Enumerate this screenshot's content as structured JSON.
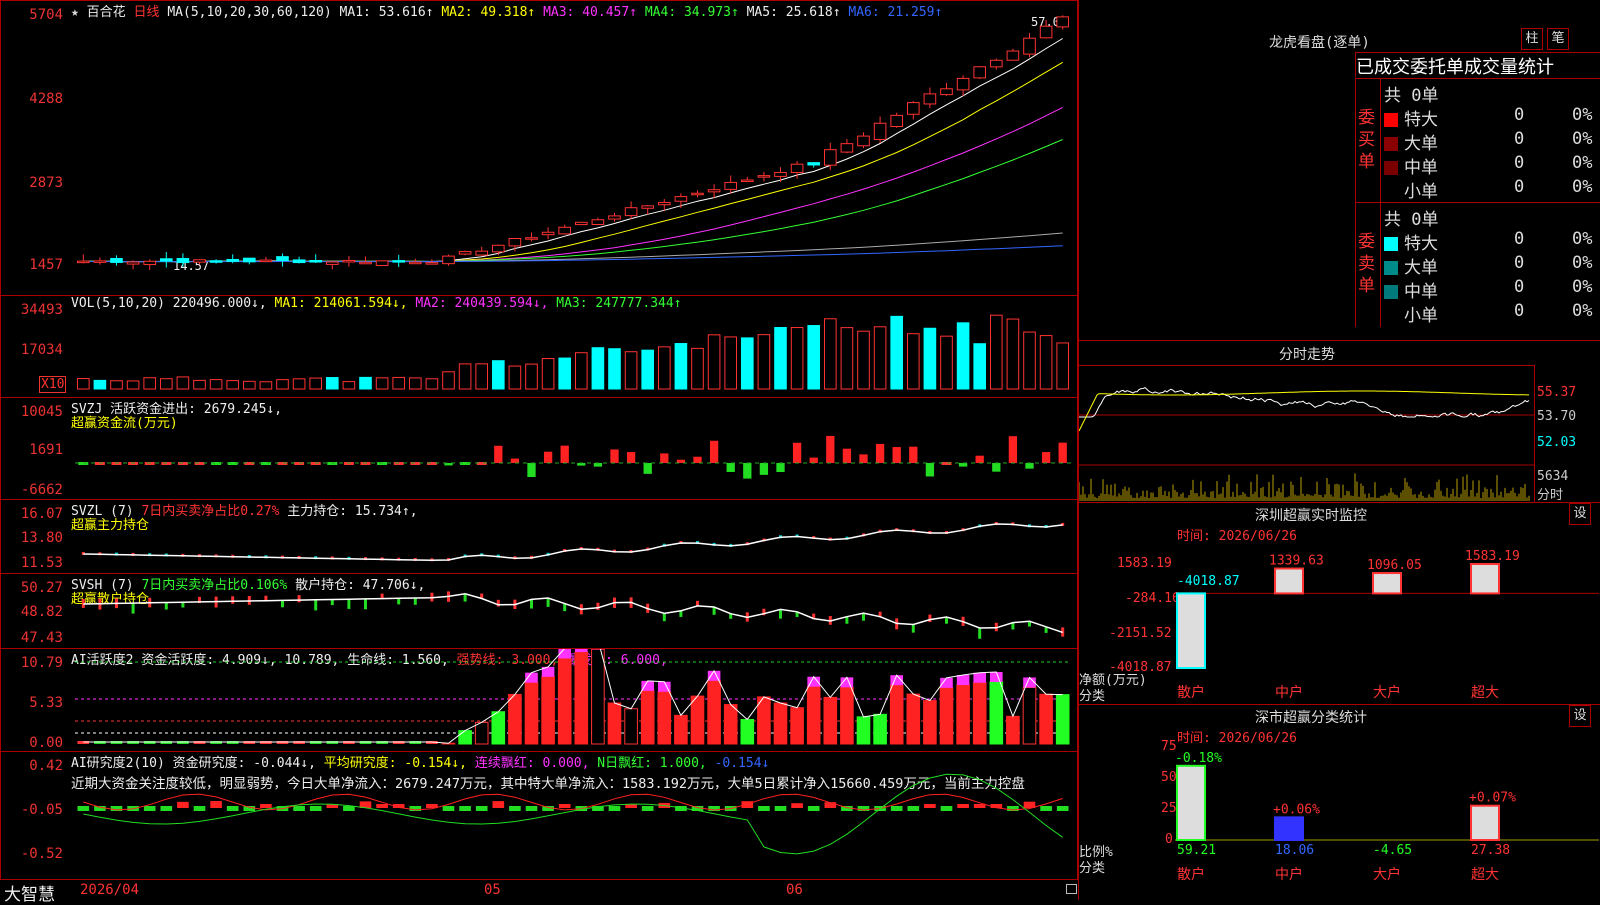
{
  "kline": {
    "stock_name": "百合花",
    "period": "日线",
    "ma_spec": "MA(5,10,20,30,60,120)",
    "ma": [
      {
        "label": "MA1:",
        "value": "53.616↑",
        "color": "#ffffff"
      },
      {
        "label": "MA2:",
        "value": "49.318↑",
        "color": "#ffff00"
      },
      {
        "label": "MA3:",
        "value": "40.457↑",
        "color": "#ff33ff"
      },
      {
        "label": "MA4:",
        "value": "34.973↑",
        "color": "#33ff33"
      },
      {
        "label": "MA5:",
        "value": "25.618↑",
        "color": "#cccccc"
      },
      {
        "label": "MA6:",
        "value": "21.259↑",
        "color": "#3366ff"
      }
    ],
    "y_ticks": [
      "5704",
      "4288",
      "2873",
      "1457"
    ],
    "high_label": "57.04",
    "low_label": "14.57"
  },
  "volume": {
    "spec": "VOL(5,10,20)",
    "value": "220496.000↓,",
    "ma1": "MA1: 214061.594↓,",
    "ma2": "MA2: 240439.594↓,",
    "ma3": "MA3: 247777.344↑",
    "y_ticks": [
      "34493",
      "17034"
    ],
    "unit": "X10"
  },
  "svzj": {
    "title": "SVZJ",
    "text": "活跃资金进出: 2679.245↓,",
    "sub": "超赢资金流(万元)",
    "y_ticks": [
      "10045",
      "1691",
      "-6662"
    ]
  },
  "svzl": {
    "title": "SVZL (7)",
    "desc": "7日内买卖净占比0.27%",
    "value": "主力持仓: 15.734↑,",
    "sub": "超赢主力持仓",
    "y_ticks": [
      "16.07",
      "13.80",
      "11.53"
    ]
  },
  "svsh": {
    "title": "SVSH (7)",
    "desc": "7日内买卖净占比0.106%",
    "value": "散户持仓: 47.706↓,",
    "sub": "超赢散户持仓",
    "y_ticks": [
      "50.27",
      "48.82",
      "47.43"
    ]
  },
  "ai1": {
    "title": "AI活跃度2",
    "v1": "资金活跃度: 4.909↓,",
    "v2": "10.789,",
    "v3": "生命线: 1.560,",
    "v4": "强势线: 3.000,",
    "v5": "爆发线: 6.000,",
    "y_ticks": [
      "10.79",
      "5.33",
      "0.00"
    ]
  },
  "ai2": {
    "title": "AI研究度2(10)",
    "v1": "资金研究度: -0.044↓,",
    "v2": "平均研究度: -0.154↓,",
    "v3": "连续飘红: 0.000,",
    "v4": "N日飘红: 1.000,",
    "v5": "-0.154↓",
    "note": "近期大资金关注度较低，明显弱势，今日大单净流入：2679.247万元，其中特大单净流入：1583.192万元，大单5日累计净入15660.459万元，当前主力控盘",
    "y_ticks": [
      "0.42",
      "-0.05",
      "-0.52"
    ]
  },
  "bottom": {
    "brand": "大智慧",
    "dates": [
      "2026/04",
      "05",
      "06"
    ]
  },
  "right": {
    "lhk_title": "龙虎看盘(逐单)",
    "btn_zhu": "柱",
    "btn_bi": "笔",
    "tabs": [
      "已成交",
      "委托单",
      "成交量统计"
    ],
    "buy_label": "委买单",
    "sell_label": "委卖单",
    "buy_total": "共 0单",
    "sell_total": "共 0单",
    "buy_rows": [
      {
        "name": "特大",
        "count": "0",
        "pct": "0%",
        "color": "#ff0000"
      },
      {
        "name": "大单",
        "count": "0",
        "pct": "0%",
        "color": "#8b0000"
      },
      {
        "name": "中单",
        "count": "0",
        "pct": "0%",
        "color": "#7a0000"
      },
      {
        "name": "小单",
        "count": "0",
        "pct": "0%",
        "color": "#000000"
      }
    ],
    "sell_rows": [
      {
        "name": "特大",
        "count": "0",
        "pct": "0%",
        "color": "#00ffff"
      },
      {
        "name": "大单",
        "count": "0",
        "pct": "0%",
        "color": "#008b8b"
      },
      {
        "name": "中单",
        "count": "0",
        "pct": "0%",
        "color": "#007a7a"
      },
      {
        "name": "小单",
        "count": "0",
        "pct": "0%",
        "color": "#000000"
      }
    ],
    "fs_title": "分时走势",
    "fs_ticks": [
      "55.37",
      "53.70",
      "52.03"
    ],
    "fs_vol": "5634",
    "fs_vol_label": "分时",
    "sz_title": "深圳超赢实时监控",
    "sz_btn": "设",
    "sz_time": "时间: 2026/06/26",
    "sz_ticks": [
      "1583.19",
      "-284.16",
      "-2151.52",
      "-4018.87"
    ],
    "sz_ylabel": "净额(万元)",
    "sz_xlabel": "分类",
    "sz_cats": [
      "散户",
      "中户",
      "大户",
      "超大"
    ],
    "sz_values": [
      -4018.87,
      1339.63,
      1096.05,
      1583.19
    ],
    "sz_value_labels": [
      "-4018.87",
      "1339.63",
      "1096.05",
      "1583.19"
    ],
    "st_title": "深市超赢分类统计",
    "st_btn": "设",
    "st_time": "时间: 2026/06/26",
    "st_ticks": [
      "75",
      "50",
      "25",
      "0"
    ],
    "st_ylabel": "比例%",
    "st_xlabel": "分类",
    "st_cats": [
      "散户",
      "中户",
      "大户",
      "超大"
    ],
    "st_values": [
      59.21,
      18.06,
      -4.65,
      27.38
    ],
    "st_value_labels": [
      "59.21",
      "18.06",
      "-4.65",
      "27.38"
    ],
    "st_change_labels": [
      "-0.18%",
      "+0.06%",
      "",
      "+0.07%"
    ]
  }
}
